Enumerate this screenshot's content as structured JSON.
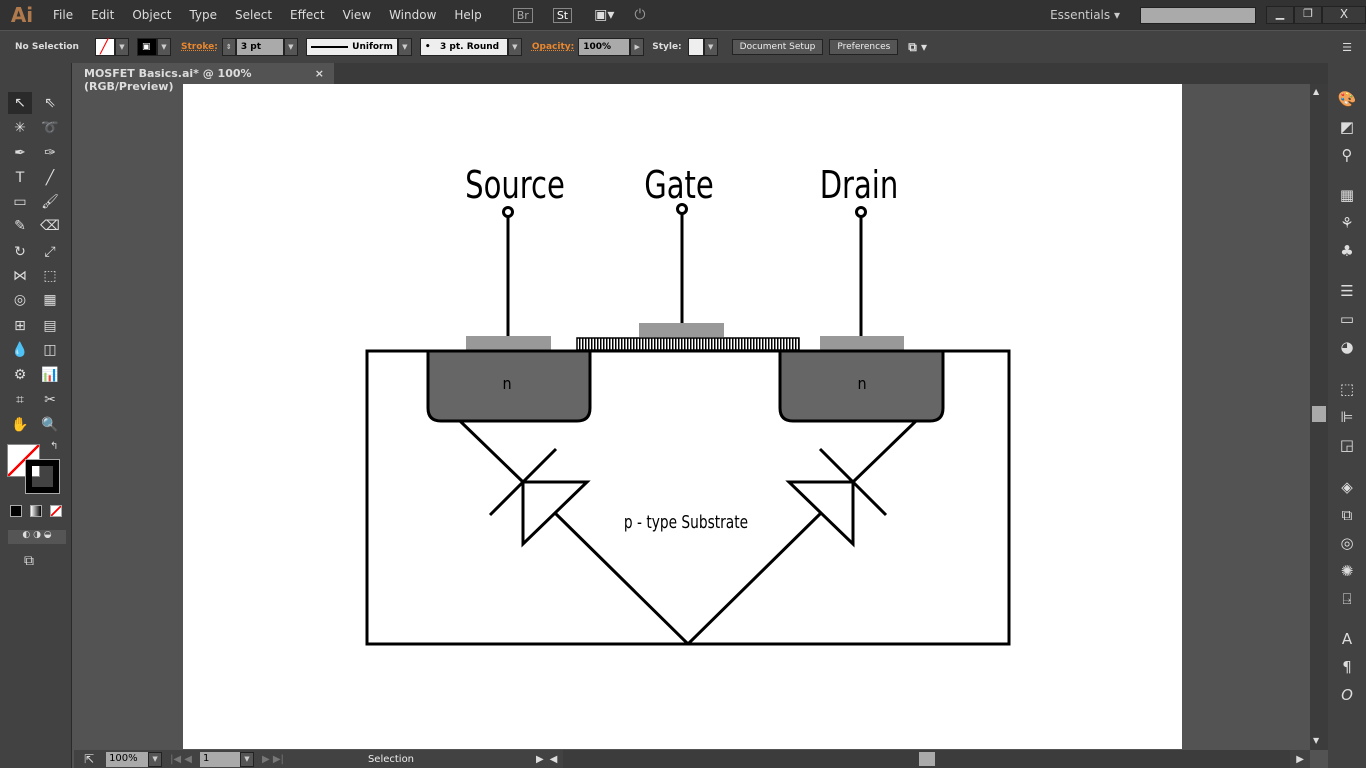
{
  "app": {
    "logo": "Ai",
    "menu": [
      "File",
      "Edit",
      "Object",
      "Type",
      "Select",
      "Effect",
      "View",
      "Window",
      "Help"
    ],
    "bridge": "Br",
    "stock": "St",
    "workspace": "Essentials",
    "search_placeholder": ""
  },
  "control": {
    "selection": "No Selection",
    "stroke_label": "Stroke:",
    "stroke_value": "3 pt",
    "profile": "Uniform",
    "brush": "3 pt. Round",
    "opacity_label": "Opacity:",
    "opacity_value": "100%",
    "style_label": "Style:",
    "document_setup": "Document Setup",
    "preferences": "Preferences"
  },
  "document": {
    "tab_title": "MOSFET Basics.ai* @ 100% (RGB/Preview)",
    "close": "×"
  },
  "diagram": {
    "source": "Source",
    "gate": "Gate",
    "drain": "Drain",
    "n_left": "n",
    "n_right": "n",
    "substrate": "p - type Substrate",
    "colors": {
      "well": "#666666",
      "contact": "#999999",
      "stroke": "#000000"
    }
  },
  "status": {
    "zoom": "100%",
    "artboard": "1",
    "tool": "Selection"
  }
}
